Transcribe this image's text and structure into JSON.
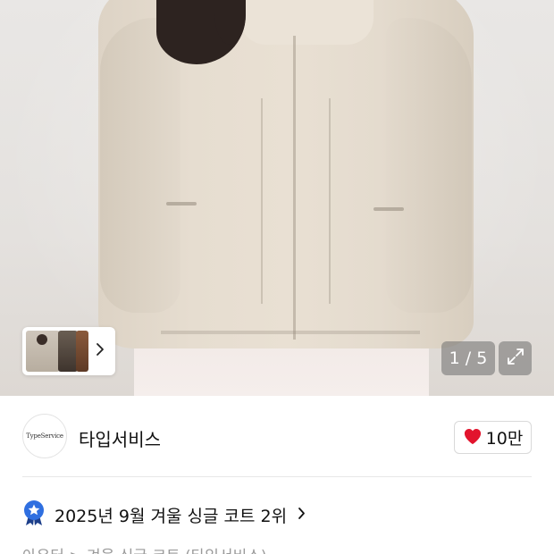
{
  "gallery": {
    "counter": "1 / 5",
    "current": 1,
    "total": 5
  },
  "icons": {
    "expand": "expand-icon",
    "chevron": "chevron-right-icon",
    "heart": "heart-icon",
    "badge": "rank-badge-icon"
  },
  "brand": {
    "logo_text": "TypeService",
    "name": "타입서비스"
  },
  "like": {
    "count": "10만",
    "heart_color": "#e2142d"
  },
  "ranking": {
    "text": "2025년 9월 겨울 싱글 코트 2위",
    "badge_color": "#2f6fe0"
  },
  "breadcrumb": {
    "text": "아우터 > 겨울 싱글 코트 (타입서비스)"
  }
}
